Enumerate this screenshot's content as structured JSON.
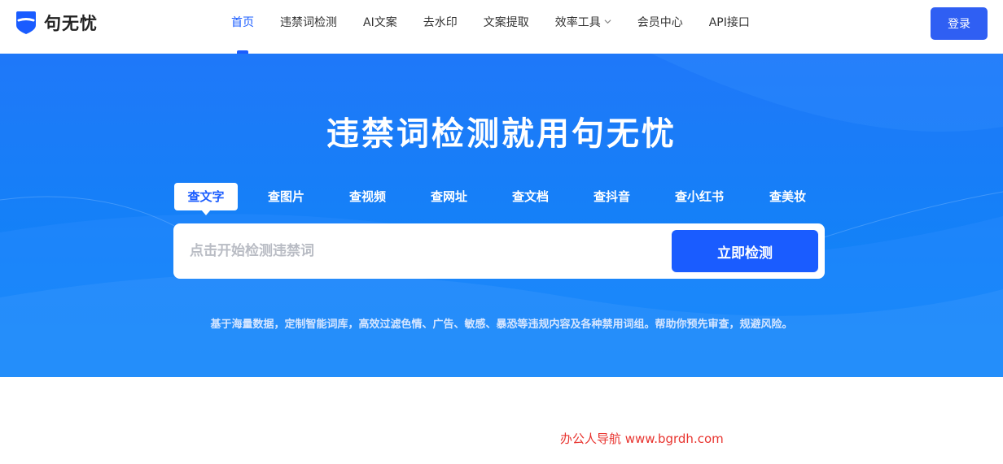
{
  "header": {
    "logo_text": "句无忧",
    "nav": [
      {
        "label": "首页",
        "active": true
      },
      {
        "label": "违禁词检测"
      },
      {
        "label": "AI文案"
      },
      {
        "label": "去水印"
      },
      {
        "label": "文案提取"
      },
      {
        "label": "效率工具",
        "dropdown": true
      },
      {
        "label": "会员中心"
      },
      {
        "label": "API接口"
      }
    ],
    "login_label": "登录"
  },
  "hero": {
    "title": "违禁词检测就用句无忧",
    "tabs": [
      {
        "label": "查文字",
        "active": true
      },
      {
        "label": "查图片"
      },
      {
        "label": "查视频"
      },
      {
        "label": "查网址"
      },
      {
        "label": "查文档"
      },
      {
        "label": "查抖音"
      },
      {
        "label": "查小红书"
      },
      {
        "label": "查美妆"
      }
    ],
    "search_placeholder": "点击开始检测违禁词",
    "detect_button": "立即检测",
    "description": "基于海量数据，定制智能词库，高效过滤色情、广告、敏感、暴恐等违规内容及各种禁用词组。帮助你预先审查，规避风险。"
  },
  "watermark": "办公人导航  www.bgrdh.com",
  "colors": {
    "accent": "#1a5cff",
    "hero_bg": "#1f78f9",
    "watermark": "#e8342f"
  }
}
